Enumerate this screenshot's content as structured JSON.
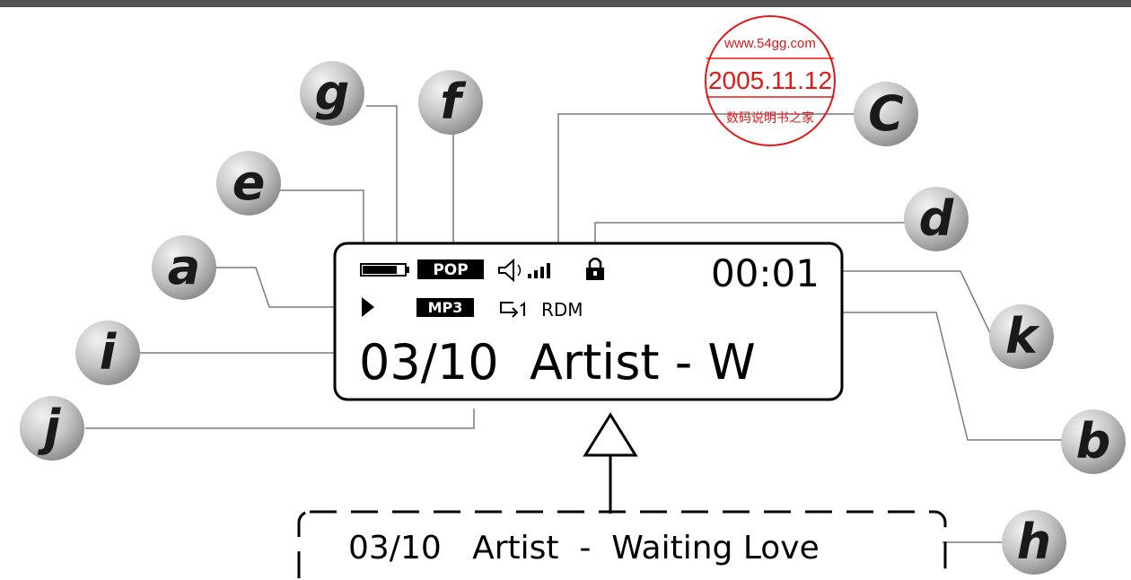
{
  "display": {
    "top_right_time": "00:01",
    "main_line": "03/10  Artist - W",
    "genre_badge": "POP",
    "format_badge": "MP3",
    "repeat_mode": "RDM"
  },
  "scroll_line": {
    "text": "03/10   Artist  -  Waiting Love"
  },
  "callouts": {
    "a": "a",
    "b": "b",
    "c": "C",
    "d": "d",
    "e": "e",
    "f": "f",
    "g": "g",
    "h": "h",
    "i": "i",
    "j": "j",
    "k": "k"
  },
  "stamp": {
    "url": "www.54gg.com",
    "date": "2005.11.12",
    "caption": "数码说明书之家",
    "color": "#e01818"
  },
  "icons": [
    "battery-icon",
    "play-icon",
    "volume-icon",
    "signal-bars-icon",
    "lock-icon",
    "repeat-one-icon",
    "up-arrow-icon"
  ]
}
